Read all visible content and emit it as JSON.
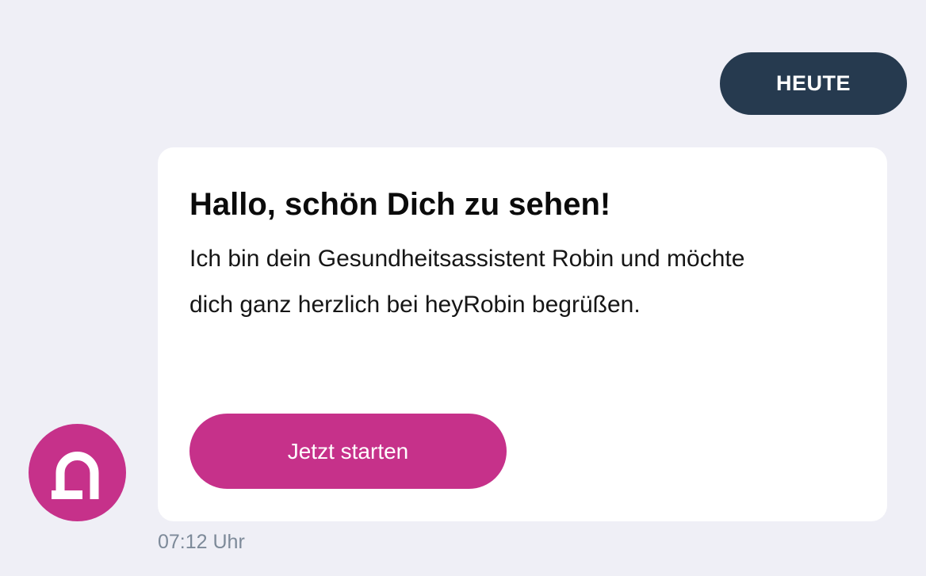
{
  "header": {
    "day_label": "HEUTE"
  },
  "message": {
    "title": "Hallo, schön Dich zu sehen!",
    "body": "Ich bin dein Gesundheitsassistent Robin und möchte dich ganz herzlich bei heyRobin begrüßen.",
    "button_label": "Jetzt starten",
    "timestamp": "07:12 Uhr"
  },
  "avatar": {
    "icon": "robin-logo-icon"
  },
  "colors": {
    "background": "#efeff6",
    "pill": "#263a4f",
    "accent": "#c6318a",
    "card": "#ffffff",
    "timestamp": "#7d8a99"
  }
}
